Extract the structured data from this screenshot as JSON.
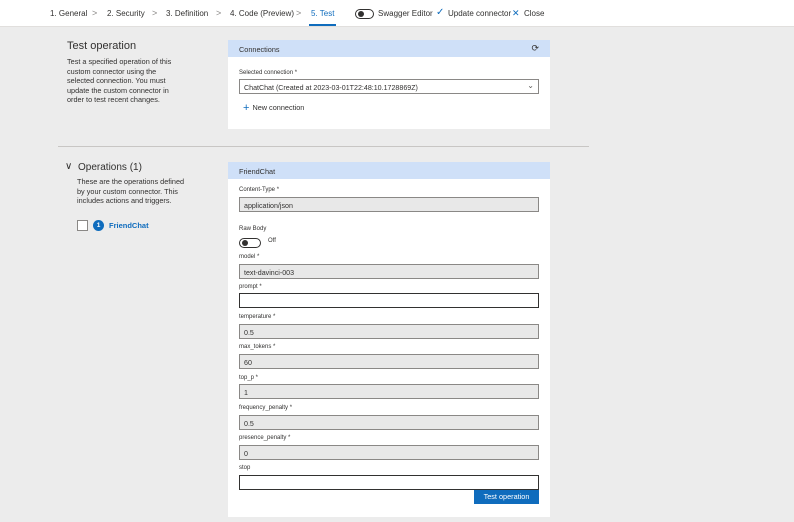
{
  "nav": {
    "steps": [
      "1. General",
      "2. Security",
      "3. Definition",
      "4. Code (Preview)",
      "5. Test"
    ],
    "separator": ">",
    "swagger_label": "Swagger Editor",
    "update_label": "Update connector",
    "close_label": "Close",
    "check_icon": "✓",
    "close_icon": "✕"
  },
  "test_section": {
    "title": "Test operation",
    "description": "Test a specified operation of this custom connector using the selected connection. You must update the custom connector in order to test recent changes."
  },
  "connections": {
    "header": "Connections",
    "refresh_icon": "⟳",
    "selected_label": "Selected connection *",
    "selected_value": "ChatChat (Created at 2023-03-01T22:48:10.1728869Z)",
    "new_connection_label": "New connection",
    "plus_icon": "+"
  },
  "operations": {
    "title": "Operations (1)",
    "chevron_icon": "∨",
    "description": "These are the operations defined by your custom connector. This includes actions and triggers.",
    "items": [
      {
        "badge": "1",
        "name": "FriendChat"
      }
    ]
  },
  "friendchat": {
    "header": "FriendChat",
    "content_type": {
      "label": "Content-Type *",
      "value": "application/json"
    },
    "raw_body": {
      "label": "Raw Body",
      "state": "Off"
    },
    "model": {
      "label": "model *",
      "value": "text-davinci-003"
    },
    "prompt": {
      "label": "prompt *",
      "value": ""
    },
    "temperature": {
      "label": "temperature *",
      "value": "0.5"
    },
    "max_tokens": {
      "label": "max_tokens *",
      "value": "60"
    },
    "top_p": {
      "label": "top_p *",
      "value": "1"
    },
    "frequency_penalty": {
      "label": "frequency_penalty *",
      "value": "0.5"
    },
    "presence_penalty": {
      "label": "presence_penalty *",
      "value": "0"
    },
    "stop": {
      "label": "stop",
      "value": ""
    },
    "test_button": "Test operation"
  },
  "colors": {
    "accent": "#0f6cbd",
    "panel_header": "#cfe0f8",
    "background": "#ececec"
  }
}
